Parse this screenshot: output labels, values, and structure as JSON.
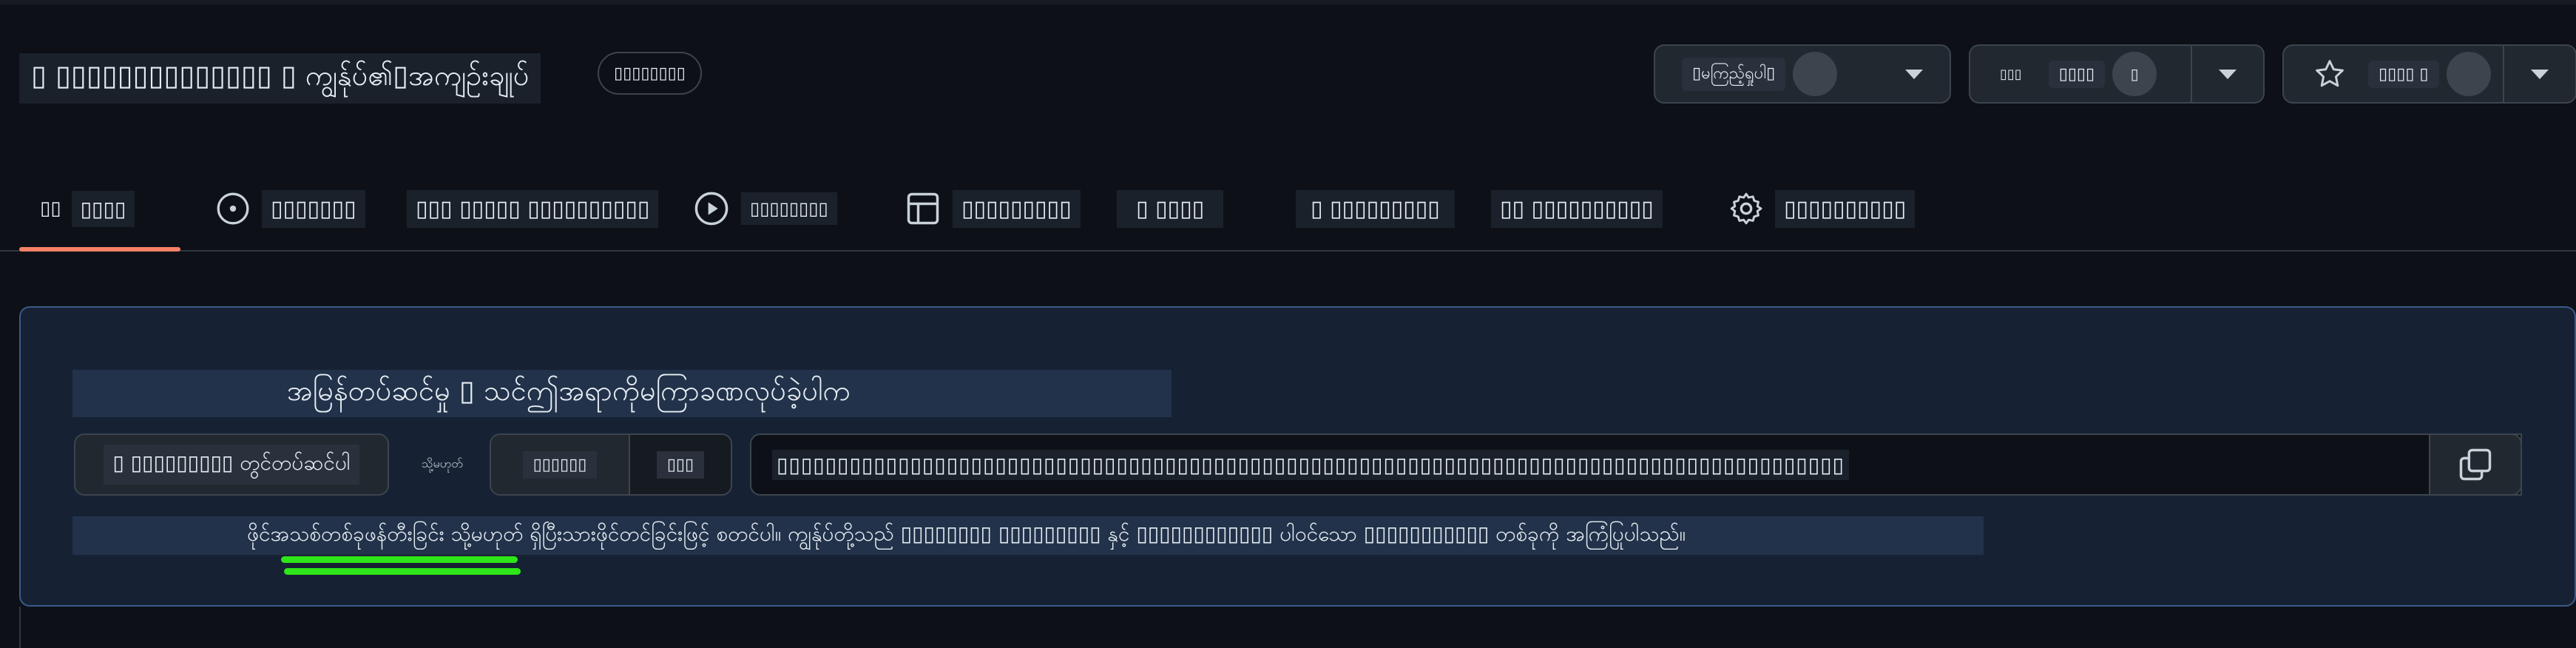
{
  "repo": {
    "title": "▯ ▯▯▯▯▯▯▯▯▯▯▯▯▯▯ ▯ ကျွန်ုပ်၏▯အကျဉ်းချုပ်",
    "visibility_badge": "▯▯▯▯▯▯▯▯"
  },
  "header_actions": {
    "watch": {
      "label": "▯မကြည့်ရှုပါ▯",
      "count": "",
      "icon": "eye-icon"
    },
    "fork": {
      "label": "▯▯▯▯",
      "count": "▯",
      "icon": "fork-icon",
      "glyph": "▯▯▯"
    },
    "star": {
      "label": "▯▯▯▯ ▯",
      "count": "",
      "icon": "star-icon"
    }
  },
  "tabs": [
    {
      "label": "▯▯▯▯",
      "prefix": "▯▯ ",
      "icon": "code-icon",
      "active": true
    },
    {
      "label": "▯▯▯▯▯▯▯",
      "icon": "issue-opened-icon"
    },
    {
      "label": "▯▯▯ ▯▯▯▯▯ ▯▯▯▯▯▯▯▯▯▯",
      "icon": "git-pull-request-icon"
    },
    {
      "label": "▯▯▯▯▯▯▯▯",
      "icon": "play-icon"
    },
    {
      "label": "▯▯▯▯▯▯▯▯▯",
      "icon": "table-icon"
    },
    {
      "label": "▯ ▯▯▯▯",
      "icon": "book-icon"
    },
    {
      "label": "▯ ▯▯▯▯▯▯▯▯▯",
      "icon": "shield-icon"
    },
    {
      "label": "▯▯ ▯▯▯▯▯▯▯▯▯▯",
      "icon": "graph-icon"
    },
    {
      "label": "▯▯▯▯▯▯▯▯▯▯",
      "icon": "gear-icon"
    }
  ],
  "quick_setup": {
    "title": "အမြန်တပ်ဆင်မှု ▯ သင်ဤအရာကိုမကြာခဏလုပ်ခဲ့ပါက",
    "setup_button": "▯ ▯▯▯▯▯▯▯▯▯ တွင်တပ်ဆင်ပါ",
    "or_text": "သို့မဟုတ်",
    "protocol_options": [
      "▯▯▯▯▯▯",
      "▯▯▯"
    ],
    "clone_url": "▯▯▯▯▯▯▯▯▯▯▯▯▯▯▯▯▯▯▯▯▯▯▯▯▯▯▯▯▯▯▯▯▯▯▯▯▯▯▯▯▯▯▯▯▯▯▯▯▯▯▯▯▯▯▯▯▯▯▯▯▯▯▯▯▯▯▯▯▯▯▯▯▯▯▯▯▯▯▯▯▯▯▯▯▯▯▯▯",
    "copy_icon": "copy-icon",
    "hint": "ဖိုင်အသစ်တစ်ခုဖန်တီးခြင်း သို့မဟုတ် ရှိပြီးသားဖိုင်တင်ခြင်းဖြင့် စတင်ပါ။ ကျွန်ုပ်တို့သည် ▯▯▯▯▯▯▯▯ ▯▯▯▯▯▯▯▯▯ နှင့် ▯▯▯▯▯▯▯▯▯▯▯▯ ပါဝင်သော ▯▯▯▯▯▯▯▯▯▯▯ တစ်ခုကို အကြံပြုပါသည်။"
  },
  "colors": {
    "background": "#0d1117",
    "active_tab_underline": "#f78166",
    "panel_border": "#3b5a8a",
    "highlight_underline": "#2ee51a"
  }
}
